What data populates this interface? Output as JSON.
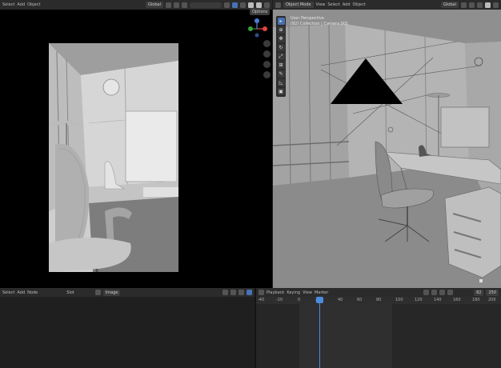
{
  "top_left_header": {
    "menus": [
      "Select",
      "Add",
      "Object"
    ],
    "transform_orientation": "Global",
    "options": "Options"
  },
  "top_right_header": {
    "mode": "Object Mode",
    "menus": [
      "View",
      "Select",
      "Add",
      "Object"
    ],
    "transform_orientation": "Global"
  },
  "viewport_right": {
    "overlay_line1": "User Perspective",
    "overlay_line2": "(82) Collection | Camera.001"
  },
  "bottom_left_header": {
    "menus": [
      "Select",
      "Add",
      "Node"
    ],
    "slot_label": "Slot",
    "image_name": "Image"
  },
  "timeline": {
    "menus": [
      "Playback",
      "Keying",
      "View",
      "Marker"
    ],
    "ruler_ticks": [
      "-40",
      "-20",
      "0",
      "20",
      "40",
      "60",
      "80",
      "100",
      "120",
      "140",
      "160",
      "180",
      "200",
      "220"
    ],
    "current_frame": "82",
    "end_frame": "250"
  },
  "colors": {
    "accent_blue": "#4772b3",
    "header_bg": "#2b2b2b",
    "viewport_grey": "#9a9a9a",
    "playhead": "#4a8de0"
  }
}
